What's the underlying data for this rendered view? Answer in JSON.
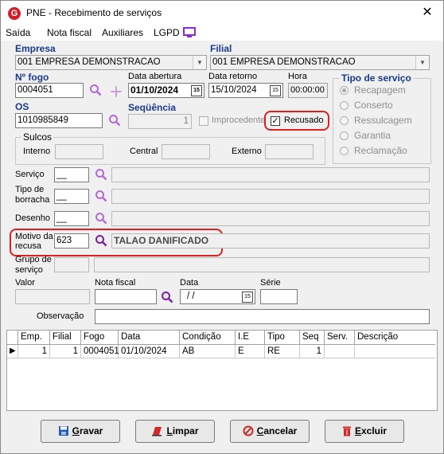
{
  "window": {
    "title": "PNE - Recebimento de serviços",
    "close": "✕",
    "app_icon": "G"
  },
  "menu": [
    "Saída",
    "Nota fiscal",
    "Auxiliares",
    "LGPD"
  ],
  "empresa": {
    "label": "Empresa",
    "value": "001 EMPRESA DEMONSTRACAO"
  },
  "filial": {
    "label": "Filial",
    "value": "001 EMPRESA DEMONSTRACAO"
  },
  "fogo": {
    "label": "Nº  fogo",
    "value": "0004051"
  },
  "data_abertura": {
    "label": "Data abertura",
    "value": "01/10/2024"
  },
  "data_retorno": {
    "label": "Data retorno",
    "value": "15/10/2024"
  },
  "hora": {
    "label": "Hora",
    "value": "00:00:00"
  },
  "cal_glyph": "15",
  "os": {
    "label": "OS",
    "value": "1010985849"
  },
  "sequencia": {
    "label": "Seqüência",
    "value": "1"
  },
  "improcedente": {
    "label": "Improcedente",
    "checked": false
  },
  "recusado": {
    "label": "Recusado",
    "checked": true,
    "mark": "✓"
  },
  "tipo_servico": {
    "title": "Tipo de serviço",
    "options": [
      "Recapagem",
      "Conserto",
      "Ressulcagem",
      "Garantia",
      "Reclamação"
    ],
    "selected": "Recapagem"
  },
  "sulcos": {
    "title": "Sulcos",
    "interno": "Interno",
    "central": "Central",
    "externo": "Externo"
  },
  "servico": {
    "label": "Serviço",
    "code": "__"
  },
  "tipo_borracha": {
    "label": "Tipo de borracha",
    "code": "__"
  },
  "desenho": {
    "label": "Desenho",
    "code": "__"
  },
  "motivo_recusa": {
    "label": "Motivo da recusa",
    "code": "623",
    "description": "TALAO DANIFICADO"
  },
  "grupo_servico": {
    "label": "Grupo de serviço"
  },
  "valor": {
    "label": "Valor"
  },
  "nota_fiscal": {
    "label": "Nota fiscal"
  },
  "data": {
    "label": "Data",
    "value": "/ /"
  },
  "serie": {
    "label": "Série"
  },
  "observacao": {
    "label": "Observação"
  },
  "grid": {
    "columns": [
      "Emp.",
      "Filial",
      "Fogo",
      "Data",
      "Condição",
      "I.E",
      "Tipo",
      "Seq",
      "Serv.",
      "Descrição"
    ],
    "rows": [
      [
        "1",
        "1",
        "0004051",
        "01/10/2024",
        "AB",
        "E",
        "RE",
        "1",
        "",
        ""
      ]
    ]
  },
  "buttons": {
    "gravar": {
      "first": "G",
      "rest": "ravar"
    },
    "limpar": {
      "first": "L",
      "rest": "impar"
    },
    "cancelar": {
      "first": "C",
      "rest": "ancelar"
    },
    "excluir": {
      "first": "E",
      "rest": "xcluir"
    }
  },
  "colors": {
    "label_blue": "#1a3a8f",
    "highlight_red": "#e02020",
    "search_purple": "#7a1fa2",
    "lgpd_purple": "#8a2be2"
  }
}
